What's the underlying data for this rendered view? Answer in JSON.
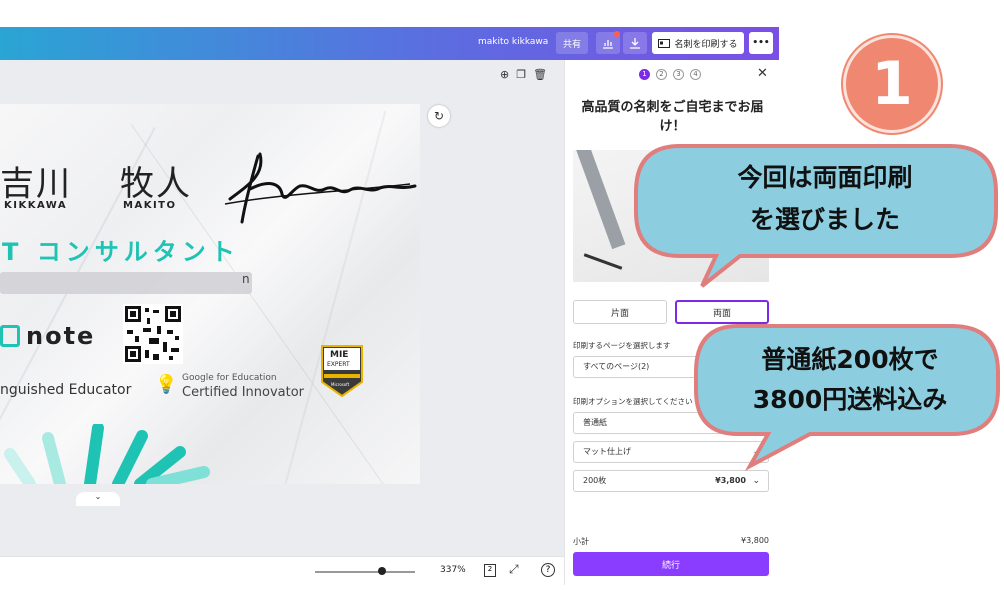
{
  "topbar": {
    "user": "makito kikkawa",
    "share_label": "共有",
    "print_label": "名刺を印刷する",
    "more_label": "•••"
  },
  "canvas": {
    "name_family": "吉川",
    "name_given": "牧人",
    "name_family_en": "KIKKAWA",
    "name_given_en": "MAKITO",
    "signature": "Kikkawa",
    "title": "T コンサルタント",
    "blur_suffix": "n",
    "note_text": "note",
    "educator": "nguished Educator",
    "gfe_line1": "Google for Education",
    "gfe_line2": "Certified Innovator",
    "mie_line1": "MIE",
    "mie_line2": "EXPERT",
    "mie_line3": "Microsoft",
    "zoom": "337%",
    "page_count": "2"
  },
  "panel": {
    "steps": [
      "1",
      "2",
      "3",
      "4"
    ],
    "title": "高品質の名刺をご自宅までお届け！",
    "single_side": "片面",
    "double_side": "両面",
    "select_pages_label": "印刷するページを選択します",
    "pages_value": "すべてのページ(2)",
    "options_label": "印刷オプションを選択してください",
    "paper": "普通紙",
    "finish": "マット仕上げ",
    "quantity": "200枚",
    "price": "¥3,800",
    "subtotal_label": "小計",
    "subtotal_value": "¥3,800",
    "continue_label": "続行"
  },
  "overlay": {
    "step_number": "1",
    "bubble1_line1": "今回は両面印刷",
    "bubble1_line2": "を選びました",
    "bubble2_line1": "普通紙200枚で",
    "bubble2_line2": "3800円送料込み",
    "colors": {
      "bubble": "#8ccee0",
      "bubble_border": "#e07d7d",
      "number": "#f08770"
    }
  }
}
